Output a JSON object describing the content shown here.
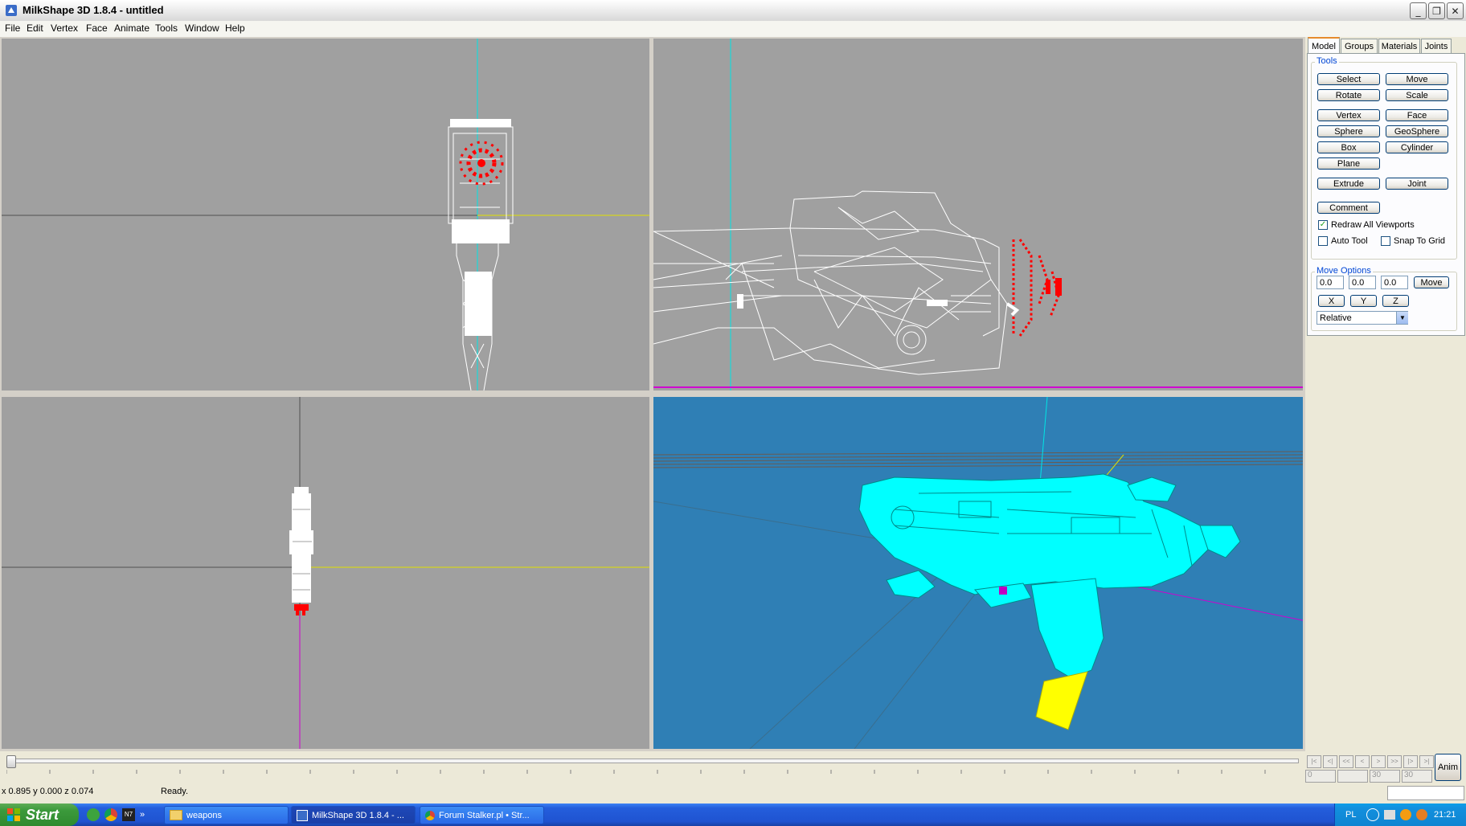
{
  "window": {
    "title": "MilkShape 3D 1.8.4 - untitled",
    "controls": {
      "minimize": "_",
      "restore": "❐",
      "close": "✕"
    }
  },
  "menu": [
    "File",
    "Edit",
    "Vertex",
    "Face",
    "Animate",
    "Tools",
    "Window",
    "Help"
  ],
  "panel": {
    "tabs": [
      "Model",
      "Groups",
      "Materials",
      "Joints"
    ],
    "active_tab": "Model",
    "tools_label": "Tools",
    "tool_buttons": {
      "select": "Select",
      "move": "Move",
      "rotate": "Rotate",
      "scale": "Scale",
      "vertex": "Vertex",
      "face": "Face",
      "sphere": "Sphere",
      "geosphere": "GeoSphere",
      "box": "Box",
      "cylinder": "Cylinder",
      "plane": "Plane",
      "extrude": "Extrude",
      "joint": "Joint",
      "comment": "Comment"
    },
    "redraw_all": {
      "label": "Redraw All Viewports",
      "checked": true
    },
    "auto_tool": {
      "label": "Auto Tool",
      "checked": false
    },
    "snap_to_grid": {
      "label": "Snap To Grid",
      "checked": false
    },
    "move_options_label": "Move Options",
    "move_x": "0.0",
    "move_y": "0.0",
    "move_z": "0.0",
    "move_button": "Move",
    "axis_buttons": {
      "x": "X",
      "y": "Y",
      "z": "Z"
    },
    "mode_select": "Relative"
  },
  "timeline": {
    "anim_button": "Anim",
    "frame_fields": [
      "0",
      "",
      "30",
      "30"
    ]
  },
  "status": {
    "coords": "x 0.895 y 0.000 z 0.074",
    "message": "Ready."
  },
  "taskbar": {
    "start": "Start",
    "tasks": [
      "weapons",
      "MilkShape 3D 1.8.4 - ...",
      "Forum Stalker.pl • Str..."
    ],
    "language": "PL",
    "clock": "21:21"
  },
  "colors": {
    "viewport_gray": "#a0a0a0",
    "viewport_3d": "#2f7fb5",
    "model_cyan": "#00ffff",
    "selected_red": "#ff0000",
    "magazine_yellow": "#ffff00",
    "axis_cyan": "#00e5e5",
    "axis_yellow": "#e0e000",
    "axis_magenta": "#d000d0"
  },
  "icons": [
    "app-icon",
    "minimize-icon",
    "restore-icon",
    "close-icon",
    "checkmark-icon",
    "dropdown-arrow-icon",
    "windows-logo-icon",
    "folder-icon",
    "chrome-icon"
  ]
}
